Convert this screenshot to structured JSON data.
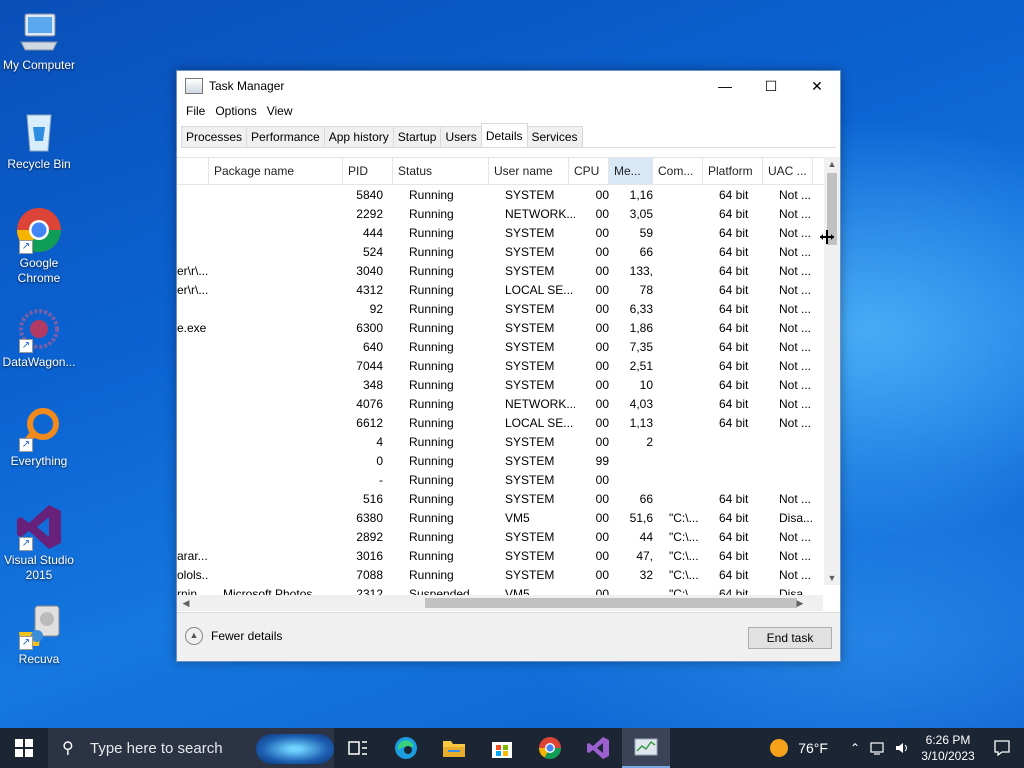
{
  "desktop": {
    "icons": [
      {
        "label": "My Computer",
        "icon": "computer-icon"
      },
      {
        "label": "Recycle Bin",
        "icon": "recycle-bin-icon"
      },
      {
        "label": "Google Chrome",
        "icon": "chrome-icon"
      },
      {
        "label": "DataWagon...",
        "icon": "datawagon-icon"
      },
      {
        "label": "Everything",
        "icon": "everything-search-icon"
      },
      {
        "label": "Visual Studio 2015",
        "icon": "visual-studio-icon"
      },
      {
        "label": "Recuva",
        "icon": "recuva-icon"
      }
    ]
  },
  "window": {
    "title": "Task Manager",
    "menu": [
      "File",
      "Options",
      "View"
    ],
    "tabs": [
      "Processes",
      "Performance",
      "App history",
      "Startup",
      "Users",
      "Details",
      "Services"
    ],
    "active_tab": "Details",
    "columns": [
      "Package name",
      "PID",
      "Status",
      "User name",
      "CPU",
      "Me...",
      "Com...",
      "Platform",
      "UAC ..."
    ],
    "rows": [
      {
        "name": "",
        "pkg": "",
        "pid": "5840",
        "status": "Running",
        "user": "SYSTEM",
        "cpu": "00",
        "mem": "1,16",
        "cmd": "",
        "plat": "64 bit",
        "uac": "Not ..."
      },
      {
        "name": "",
        "pkg": "",
        "pid": "2292",
        "status": "Running",
        "user": "NETWORK...",
        "cpu": "00",
        "mem": "3,05",
        "cmd": "",
        "plat": "64 bit",
        "uac": "Not ..."
      },
      {
        "name": "",
        "pkg": "",
        "pid": "444",
        "status": "Running",
        "user": "SYSTEM",
        "cpu": "00",
        "mem": "59",
        "cmd": "",
        "plat": "64 bit",
        "uac": "Not ..."
      },
      {
        "name": "",
        "pkg": "",
        "pid": "524",
        "status": "Running",
        "user": "SYSTEM",
        "cpu": "00",
        "mem": "66",
        "cmd": "",
        "plat": "64 bit",
        "uac": "Not ..."
      },
      {
        "name": "er\\r\\...",
        "pkg": "",
        "pid": "3040",
        "status": "Running",
        "user": "SYSTEM",
        "cpu": "00",
        "mem": "133,",
        "cmd": "",
        "plat": "64 bit",
        "uac": "Not ..."
      },
      {
        "name": "er\\r\\...",
        "pkg": "",
        "pid": "4312",
        "status": "Running",
        "user": "LOCAL SE...",
        "cpu": "00",
        "mem": "78",
        "cmd": "",
        "plat": "64 bit",
        "uac": "Not ..."
      },
      {
        "name": "",
        "pkg": "",
        "pid": "92",
        "status": "Running",
        "user": "SYSTEM",
        "cpu": "00",
        "mem": "6,33",
        "cmd": "",
        "plat": "64 bit",
        "uac": "Not ..."
      },
      {
        "name": "e.exe",
        "pkg": "",
        "pid": "6300",
        "status": "Running",
        "user": "SYSTEM",
        "cpu": "00",
        "mem": "1,86",
        "cmd": "",
        "plat": "64 bit",
        "uac": "Not ..."
      },
      {
        "name": "",
        "pkg": "",
        "pid": "640",
        "status": "Running",
        "user": "SYSTEM",
        "cpu": "00",
        "mem": "7,35",
        "cmd": "",
        "plat": "64 bit",
        "uac": "Not ..."
      },
      {
        "name": "",
        "pkg": "",
        "pid": "7044",
        "status": "Running",
        "user": "SYSTEM",
        "cpu": "00",
        "mem": "2,51",
        "cmd": "",
        "plat": "64 bit",
        "uac": "Not ..."
      },
      {
        "name": "",
        "pkg": "",
        "pid": "348",
        "status": "Running",
        "user": "SYSTEM",
        "cpu": "00",
        "mem": "10",
        "cmd": "",
        "plat": "64 bit",
        "uac": "Not ..."
      },
      {
        "name": "",
        "pkg": "",
        "pid": "4076",
        "status": "Running",
        "user": "NETWORK...",
        "cpu": "00",
        "mem": "4,03",
        "cmd": "",
        "plat": "64 bit",
        "uac": "Not ..."
      },
      {
        "name": "",
        "pkg": "",
        "pid": "6612",
        "status": "Running",
        "user": "LOCAL SE...",
        "cpu": "00",
        "mem": "1,13",
        "cmd": "",
        "plat": "64 bit",
        "uac": "Not ..."
      },
      {
        "name": "",
        "pkg": "",
        "pid": "4",
        "status": "Running",
        "user": "SYSTEM",
        "cpu": "00",
        "mem": "2",
        "cmd": "",
        "plat": "",
        "uac": ""
      },
      {
        "name": "",
        "pkg": "",
        "pid": "0",
        "status": "Running",
        "user": "SYSTEM",
        "cpu": "99",
        "mem": "",
        "cmd": "",
        "plat": "",
        "uac": ""
      },
      {
        "name": "",
        "pkg": "",
        "pid": "-",
        "status": "Running",
        "user": "SYSTEM",
        "cpu": "00",
        "mem": "",
        "cmd": "",
        "plat": "",
        "uac": ""
      },
      {
        "name": "",
        "pkg": "",
        "pid": "516",
        "status": "Running",
        "user": "SYSTEM",
        "cpu": "00",
        "mem": "66",
        "cmd": "",
        "plat": "64 bit",
        "uac": "Not ..."
      },
      {
        "name": "",
        "pkg": "",
        "pid": "6380",
        "status": "Running",
        "user": "VM5",
        "cpu": "00",
        "mem": "51,6",
        "cmd": "\"C:\\...",
        "plat": "64 bit",
        "uac": "Disa..."
      },
      {
        "name": "",
        "pkg": "",
        "pid": "2892",
        "status": "Running",
        "user": "SYSTEM",
        "cpu": "00",
        "mem": "44",
        "cmd": "\"C:\\...",
        "plat": "64 bit",
        "uac": "Not ..."
      },
      {
        "name": "arar...",
        "pkg": "",
        "pid": "3016",
        "status": "Running",
        "user": "SYSTEM",
        "cpu": "00",
        "mem": "47,",
        "cmd": "\"C:\\...",
        "plat": "64 bit",
        "uac": "Not ..."
      },
      {
        "name": "olols...",
        "pkg": "",
        "pid": "7088",
        "status": "Running",
        "user": "SYSTEM",
        "cpu": "00",
        "mem": "32",
        "cmd": "\"C:\\...",
        "plat": "64 bit",
        "uac": "Not ..."
      },
      {
        "name": "rnin...",
        "pkg": "Microsoft Photos",
        "pid": "2312",
        "status": "Suspended",
        "user": "VM5",
        "cpu": "00",
        "mem": "",
        "cmd": "\"C:\\...",
        "plat": "64 bit",
        "uac": "Disa..."
      }
    ],
    "fewer_details": "Fewer details",
    "end_task": "End task"
  },
  "taskbar": {
    "search_placeholder": "Type here to search",
    "pinned": [
      "task-view-icon",
      "edge-icon",
      "file-explorer-icon",
      "store-icon",
      "chrome-icon",
      "visual-studio-icon",
      "task-manager-icon"
    ],
    "weather": "76°F",
    "time": "6:26 PM",
    "date": "3/10/2023"
  }
}
